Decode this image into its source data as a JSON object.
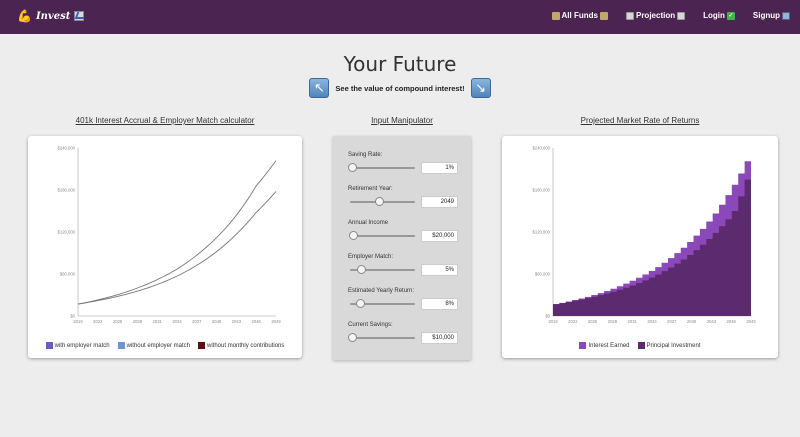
{
  "nav": {
    "brand": "Invest",
    "links": [
      {
        "label": "All Funds",
        "icon": "money-icon"
      },
      {
        "label": "Projection",
        "icon": "bar-chart-icon"
      },
      {
        "label": "Login",
        "icon": "check-icon"
      },
      {
        "label": "Signup",
        "icon": "arrow-icon"
      }
    ]
  },
  "header": {
    "title": "Your Future",
    "subtitle": "See the value of compound interest!"
  },
  "sections": {
    "left_title": "401k Interest Accrual & Employer Match calculator",
    "middle_title": "Input Manipulator",
    "right_title": "Projected Market Rate of Returns"
  },
  "inputs": [
    {
      "label": "Saving Rate:",
      "value": "1%",
      "level": 0.0
    },
    {
      "label": "Retirement Year:",
      "value": "2049",
      "level": 0.45
    },
    {
      "label": "Annual Income",
      "value": "$20,000",
      "level": 0.02
    },
    {
      "label": "Employer Match:",
      "value": "5%",
      "level": 0.15
    },
    {
      "label": "Estimated Yearly Return:",
      "value": "8%",
      "level": 0.14
    },
    {
      "label": "Current Savings:",
      "value": "$10,000",
      "level": 0.0
    }
  ],
  "chart_data": [
    {
      "type": "line",
      "x_ticks": [
        "2019",
        "2022",
        "2025",
        "2028",
        "2031",
        "2034",
        "2037",
        "2040",
        "2043",
        "2046",
        "2049"
      ],
      "y_ticks": [
        "$0",
        "$60,000",
        "$120,000",
        "$180,000",
        "$240,000"
      ],
      "ylim": [
        0,
        240000
      ],
      "series": [
        {
          "name": "with employer match",
          "color": "#6e5bc4",
          "values": [
            17000,
            23000,
            30500,
            40000,
            52000,
            67000,
            87000,
            112000,
            144000,
            186000,
            222000
          ]
        },
        {
          "name": "without employer match",
          "color": "#6a96d6",
          "values": [
            17000,
            22000,
            28000,
            35500,
            45000,
            57000,
            72500,
            92000,
            117000,
            148000,
            178000
          ]
        },
        {
          "name": "without monthly contributions",
          "color": "#5a1014",
          "values": []
        }
      ]
    },
    {
      "type": "area",
      "x_ticks": [
        "2019",
        "2022",
        "2025",
        "2028",
        "2031",
        "2034",
        "2037",
        "2040",
        "2043",
        "2046",
        "2049"
      ],
      "y_ticks": [
        "$0",
        "$60,000",
        "$120,000",
        "$180,000",
        "$240,000"
      ],
      "ylim": [
        0,
        240000
      ],
      "series": [
        {
          "name": "Interest Earned",
          "color": "#8b48b8",
          "values": [
            17000,
            23000,
            30500,
            40000,
            52000,
            67000,
            87000,
            112000,
            144000,
            186000,
            240000
          ]
        },
        {
          "name": "Principal Investment",
          "color": "#5c2a6e",
          "values": [
            17000,
            22000,
            28000,
            35500,
            45000,
            57000,
            72500,
            92000,
            117000,
            148000,
            222000
          ]
        }
      ]
    }
  ]
}
